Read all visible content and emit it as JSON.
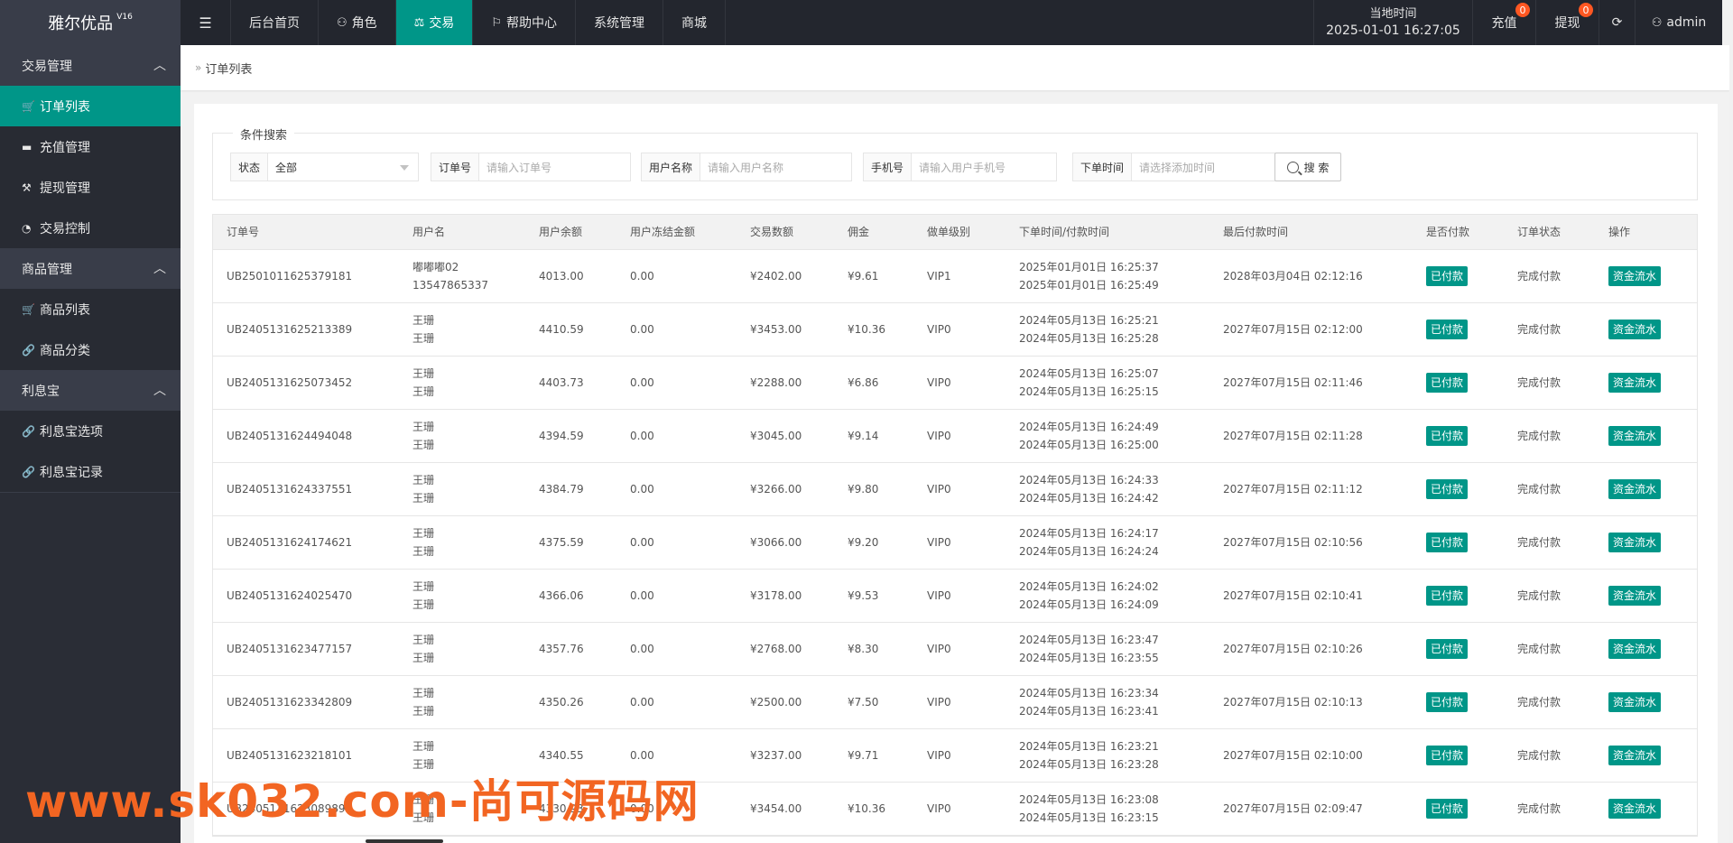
{
  "app": {
    "logo": "雅尔优品",
    "version": "V16"
  },
  "topnav": {
    "toggle_icon": "menu-fold-icon",
    "items": [
      {
        "label": "后台首页",
        "icon": ""
      },
      {
        "label": "角色",
        "icon": "user-icon"
      },
      {
        "label": "交易",
        "icon": "scale-icon",
        "active": true
      },
      {
        "label": "帮助中心",
        "icon": "flag-icon"
      },
      {
        "label": "系统管理",
        "icon": ""
      },
      {
        "label": "商城",
        "icon": ""
      }
    ]
  },
  "topright": {
    "clock_label": "当地时间",
    "clock_value": "2025-01-01 16:27:05",
    "recharge": {
      "label": "充值",
      "badge": "0"
    },
    "withdraw": {
      "label": "提现",
      "badge": "0"
    },
    "user": "admin"
  },
  "sidebar": {
    "group1": "交易管理",
    "g1items": [
      "订单列表",
      "充值管理",
      "提现管理",
      "交易控制"
    ],
    "group2": "商品管理",
    "g2items": [
      "商品列表",
      "商品分类"
    ],
    "group3": "利息宝",
    "g3items": [
      "利息宝选项",
      "利息宝记录"
    ]
  },
  "breadcrumb": {
    "current": "订单列表"
  },
  "search": {
    "legend": "条件搜索",
    "status_label": "状态",
    "status_value": "全部",
    "order_label": "订单号",
    "order_placeholder": "请输入订单号",
    "username_label": "用户名称",
    "username_placeholder": "请输入用户名称",
    "phone_label": "手机号",
    "phone_placeholder": "请输入用户手机号",
    "time_label": "下单时间",
    "time_placeholder": "请选择添加时间",
    "button": "搜 索"
  },
  "table": {
    "headers": [
      "订单号",
      "用户名",
      "用户余额",
      "用户冻结金额",
      "交易数额",
      "佣金",
      "做单级别",
      "下单时间/付款时间",
      "最后付款时间",
      "是否付款",
      "订单状态",
      "操作"
    ],
    "rows": [
      {
        "id": "UB2501011625379181",
        "user1": "嘟嘟嘟02",
        "user2": "13547865337",
        "balance": "4013.00",
        "frozen": "0.00",
        "amount": "¥2402.00",
        "commission": "¥9.61",
        "level": "VIP1",
        "t1": "2025年01月01日 16:25:37",
        "t2": "2025年01月01日 16:25:49",
        "last": "2028年03月04日 02:12:16",
        "paid": "已付款",
        "status": "完成付款",
        "action": "资金流水"
      },
      {
        "id": "UB2405131625213389",
        "user1": "王珊",
        "user2": "王珊",
        "balance": "4410.59",
        "frozen": "0.00",
        "amount": "¥3453.00",
        "commission": "¥10.36",
        "level": "VIP0",
        "t1": "2024年05月13日 16:25:21",
        "t2": "2024年05月13日 16:25:28",
        "last": "2027年07月15日 02:12:00",
        "paid": "已付款",
        "status": "完成付款",
        "action": "资金流水"
      },
      {
        "id": "UB2405131625073452",
        "user1": "王珊",
        "user2": "王珊",
        "balance": "4403.73",
        "frozen": "0.00",
        "amount": "¥2288.00",
        "commission": "¥6.86",
        "level": "VIP0",
        "t1": "2024年05月13日 16:25:07",
        "t2": "2024年05月13日 16:25:15",
        "last": "2027年07月15日 02:11:46",
        "paid": "已付款",
        "status": "完成付款",
        "action": "资金流水"
      },
      {
        "id": "UB2405131624494048",
        "user1": "王珊",
        "user2": "王珊",
        "balance": "4394.59",
        "frozen": "0.00",
        "amount": "¥3045.00",
        "commission": "¥9.14",
        "level": "VIP0",
        "t1": "2024年05月13日 16:24:49",
        "t2": "2024年05月13日 16:25:00",
        "last": "2027年07月15日 02:11:28",
        "paid": "已付款",
        "status": "完成付款",
        "action": "资金流水"
      },
      {
        "id": "UB2405131624337551",
        "user1": "王珊",
        "user2": "王珊",
        "balance": "4384.79",
        "frozen": "0.00",
        "amount": "¥3266.00",
        "commission": "¥9.80",
        "level": "VIP0",
        "t1": "2024年05月13日 16:24:33",
        "t2": "2024年05月13日 16:24:42",
        "last": "2027年07月15日 02:11:12",
        "paid": "已付款",
        "status": "完成付款",
        "action": "资金流水"
      },
      {
        "id": "UB2405131624174621",
        "user1": "王珊",
        "user2": "王珊",
        "balance": "4375.59",
        "frozen": "0.00",
        "amount": "¥3066.00",
        "commission": "¥9.20",
        "level": "VIP0",
        "t1": "2024年05月13日 16:24:17",
        "t2": "2024年05月13日 16:24:24",
        "last": "2027年07月15日 02:10:56",
        "paid": "已付款",
        "status": "完成付款",
        "action": "资金流水"
      },
      {
        "id": "UB2405131624025470",
        "user1": "王珊",
        "user2": "王珊",
        "balance": "4366.06",
        "frozen": "0.00",
        "amount": "¥3178.00",
        "commission": "¥9.53",
        "level": "VIP0",
        "t1": "2024年05月13日 16:24:02",
        "t2": "2024年05月13日 16:24:09",
        "last": "2027年07月15日 02:10:41",
        "paid": "已付款",
        "status": "完成付款",
        "action": "资金流水"
      },
      {
        "id": "UB2405131623477157",
        "user1": "王珊",
        "user2": "王珊",
        "balance": "4357.76",
        "frozen": "0.00",
        "amount": "¥2768.00",
        "commission": "¥8.30",
        "level": "VIP0",
        "t1": "2024年05月13日 16:23:47",
        "t2": "2024年05月13日 16:23:55",
        "last": "2027年07月15日 02:10:26",
        "paid": "已付款",
        "status": "完成付款",
        "action": "资金流水"
      },
      {
        "id": "UB2405131623342809",
        "user1": "王珊",
        "user2": "王珊",
        "balance": "4350.26",
        "frozen": "0.00",
        "amount": "¥2500.00",
        "commission": "¥7.50",
        "level": "VIP0",
        "t1": "2024年05月13日 16:23:34",
        "t2": "2024年05月13日 16:23:41",
        "last": "2027年07月15日 02:10:13",
        "paid": "已付款",
        "status": "完成付款",
        "action": "资金流水"
      },
      {
        "id": "UB2405131623218101",
        "user1": "王珊",
        "user2": "王珊",
        "balance": "4340.55",
        "frozen": "0.00",
        "amount": "¥3237.00",
        "commission": "¥9.71",
        "level": "VIP0",
        "t1": "2024年05月13日 16:23:21",
        "t2": "2024年05月13日 16:23:28",
        "last": "2027年07月15日 02:10:00",
        "paid": "已付款",
        "status": "完成付款",
        "action": "资金流水"
      },
      {
        "id": "UB2405131623089895",
        "user1": "王珊",
        "user2": "王珊",
        "balance": "4330.93",
        "frozen": "0.00",
        "amount": "¥3454.00",
        "commission": "¥10.36",
        "level": "VIP0",
        "t1": "2024年05月13日 16:23:08",
        "t2": "2024年05月13日 16:23:15",
        "last": "2027年07月15日 02:09:47",
        "paid": "已付款",
        "status": "完成付款",
        "action": "资金流水"
      }
    ]
  },
  "watermark": "www.sk032.com-尚可源码网",
  "colors": {
    "accent": "#009688",
    "topbar": "#23262e",
    "sidebar": "#393d49",
    "badge": "#ff5722",
    "watermark": "#f26522"
  }
}
